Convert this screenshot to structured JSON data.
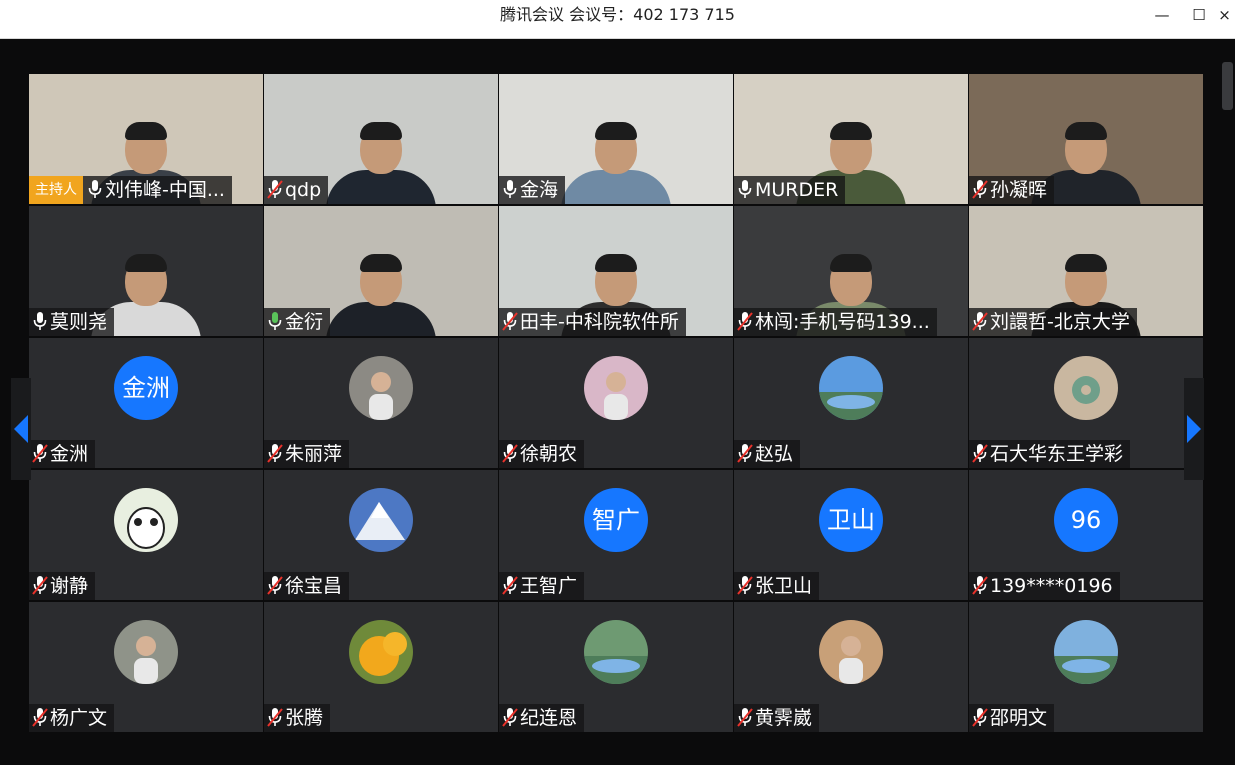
{
  "window": {
    "title": "腾讯会议 会议号：402 173 715",
    "minimize_glyph": "—",
    "maximize_glyph": "☐",
    "close_glyph": "×"
  },
  "host_badge": "主持人",
  "colors": {
    "accent_blue": "#1677ff",
    "host_orange": "#f1a51e",
    "muted_red": "#e8322b",
    "talking_green": "#5ac35a"
  },
  "participants": [
    {
      "name": "刘伟峰-中国...",
      "mic": "on",
      "host": true,
      "kind": "video",
      "bg": "#cfc7b8",
      "body": "#3a4048",
      "avatar_icon": ""
    },
    {
      "name": "qdp",
      "mic": "muted",
      "kind": "video",
      "bg": "#c9cbc8",
      "body": "#1f2630"
    },
    {
      "name": "金海",
      "mic": "on",
      "kind": "video",
      "bg": "#dcdcd8",
      "body": "#6f8aa4"
    },
    {
      "name": "MURDER",
      "mic": "on",
      "kind": "video",
      "bg": "#d6d0c4",
      "body": "#4a5a3a"
    },
    {
      "name": "孙凝晖",
      "mic": "muted",
      "kind": "video",
      "bg": "#7b6a58",
      "body": "#20242a"
    },
    {
      "name": "莫则尧",
      "mic": "on",
      "kind": "video",
      "bg": "#2f3033",
      "body": "#d9d9d9"
    },
    {
      "name": "金衍",
      "mic": "talking",
      "kind": "video",
      "bg": "#bfbcb4",
      "body": "#1d2128"
    },
    {
      "name": "田丰-中科院软件所",
      "mic": "muted",
      "kind": "video",
      "bg": "#cdd1cf",
      "body": "#2d2d2d"
    },
    {
      "name": "林闯:手机号码139...",
      "mic": "muted",
      "kind": "video",
      "bg": "#3a3b3d",
      "body": "#7a8a6a"
    },
    {
      "name": "刘譞哲-北京大学",
      "mic": "muted",
      "kind": "video",
      "bg": "#c8c2b6",
      "body": "#1a1a1a"
    },
    {
      "name": "金洲",
      "mic": "muted",
      "kind": "avatar",
      "avatar_text": "金洲"
    },
    {
      "name": "朱丽萍",
      "mic": "muted",
      "kind": "avatar",
      "avatar_icon": "woman-photo-icon",
      "avatar_bg": "#8c8a84"
    },
    {
      "name": "徐朝农",
      "mic": "muted",
      "kind": "avatar",
      "avatar_icon": "child-photo-icon",
      "avatar_bg": "#d9b7c8"
    },
    {
      "name": "赵弘",
      "mic": "muted",
      "kind": "avatar",
      "avatar_icon": "lake-photo-icon",
      "avatar_bg": "#5b9be0"
    },
    {
      "name": "石大华东王学彩",
      "mic": "muted",
      "kind": "avatar",
      "avatar_icon": "jade-pendant-icon",
      "avatar_bg": "#6f9f8a"
    },
    {
      "name": "谢静",
      "mic": "muted",
      "kind": "avatar",
      "avatar_icon": "panda-icon",
      "avatar_bg": "#e8efe0"
    },
    {
      "name": "徐宝昌",
      "mic": "muted",
      "kind": "avatar",
      "avatar_icon": "snow-mountain-icon",
      "avatar_bg": "#4d78c4"
    },
    {
      "name": "王智广",
      "mic": "muted",
      "kind": "avatar",
      "avatar_text": "智广"
    },
    {
      "name": "张卫山",
      "mic": "muted",
      "kind": "avatar",
      "avatar_text": "卫山"
    },
    {
      "name": "139****0196",
      "mic": "muted",
      "kind": "avatar",
      "avatar_text": "96"
    },
    {
      "name": "杨广文",
      "mic": "muted",
      "kind": "avatar",
      "avatar_icon": "street-photo-icon",
      "avatar_bg": "#8f9389"
    },
    {
      "name": "张腾",
      "mic": "muted",
      "kind": "avatar",
      "avatar_icon": "orange-fruit-icon",
      "avatar_bg": "#f2a81c"
    },
    {
      "name": "纪连恩",
      "mic": "muted",
      "kind": "avatar",
      "avatar_icon": "park-lake-icon",
      "avatar_bg": "#6e9a72"
    },
    {
      "name": "黄霁崴",
      "mic": "muted",
      "kind": "avatar",
      "avatar_icon": "poster-person-icon",
      "avatar_bg": "#c8a078"
    },
    {
      "name": "邵明文",
      "mic": "muted",
      "kind": "avatar",
      "avatar_icon": "mountain-lake-icon",
      "avatar_bg": "#7fb1de"
    }
  ]
}
